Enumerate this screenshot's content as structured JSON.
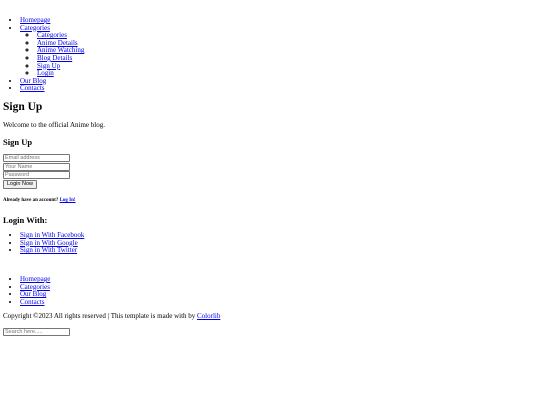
{
  "top_nav": {
    "items": [
      {
        "label": "Homepage"
      },
      {
        "label": "Categories",
        "children": [
          {
            "label": "Categories"
          },
          {
            "label": "Anime Details"
          },
          {
            "label": "Anime Watching"
          },
          {
            "label": "Blog Details"
          },
          {
            "label": "Sign Up"
          },
          {
            "label": "Login"
          }
        ]
      },
      {
        "label": "Our Blog"
      },
      {
        "label": "Contacts"
      }
    ]
  },
  "hero": {
    "title": "Sign Up",
    "welcome": "Welcome to the official Anime blog."
  },
  "signup_form": {
    "title": "Sign Up",
    "email_placeholder": "Email address",
    "name_placeholder": "Your Name",
    "password_placeholder": "Password",
    "submit_label": "Login Now",
    "account_prompt": "Already have an account?",
    "login_link": "Log In!"
  },
  "login_with": {
    "title": "Login With:",
    "items": [
      {
        "label": "Sign in With Facebook"
      },
      {
        "label": "Sign in With Google"
      },
      {
        "label": "Sign in With Twitter"
      }
    ]
  },
  "footer": {
    "nav": [
      {
        "label": "Homepage"
      },
      {
        "label": "Categories"
      },
      {
        "label": "Our Blog"
      },
      {
        "label": "Contacts"
      }
    ],
    "copyright_text": "Copyright ©2023 All rights reserved | This template is made with by",
    "credit_link": "Colorlib"
  },
  "search": {
    "placeholder": "Search here....."
  }
}
